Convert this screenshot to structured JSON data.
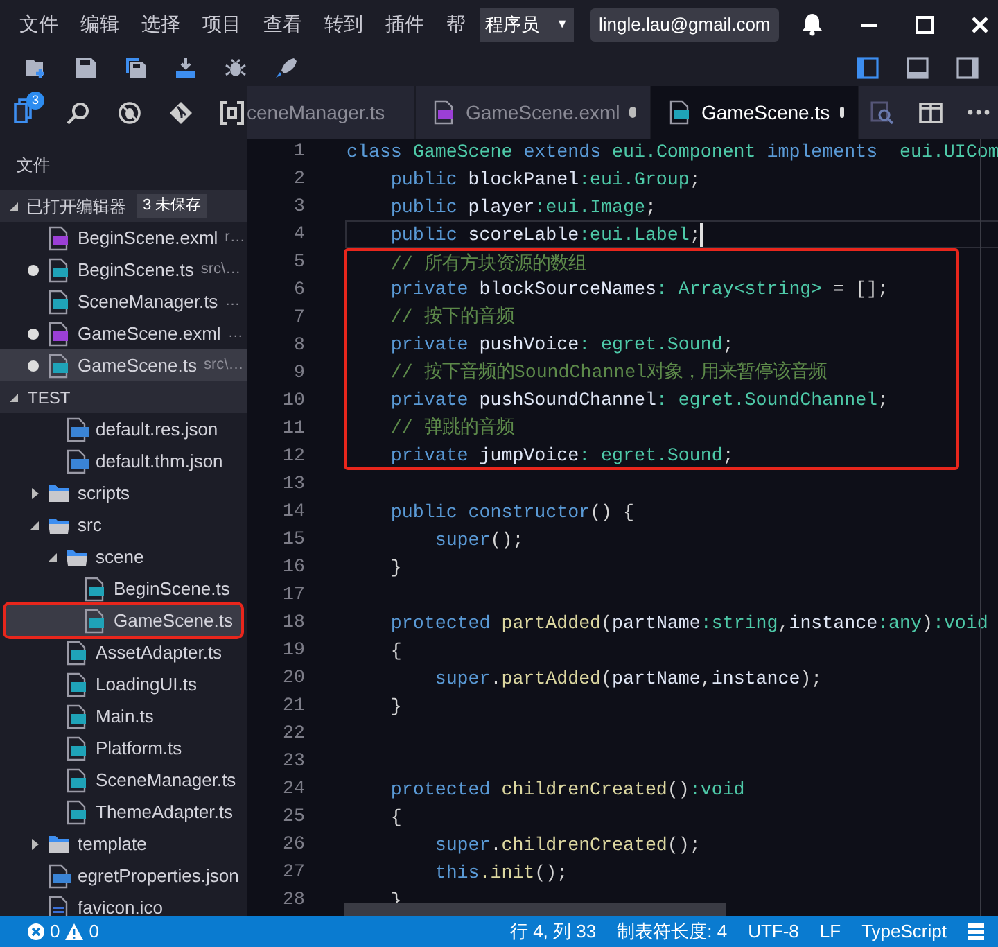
{
  "menu": [
    "文件",
    "编辑",
    "选择",
    "项目",
    "查看",
    "转到",
    "插件",
    "帮"
  ],
  "role_dropdown": {
    "value": "程序员",
    "caret": "▼"
  },
  "account": "lingle.lau@gmail.com",
  "activity": {
    "badge": "3"
  },
  "tabs": [
    {
      "label": "ceneManager.ts",
      "modified": false,
      "selected": false
    },
    {
      "label": "GameScene.exml",
      "kind": "exml",
      "modified": true,
      "selected": false
    },
    {
      "label": "GameScene.ts",
      "kind": "ts",
      "modified": true,
      "selected": true
    }
  ],
  "sidebar": {
    "title": "文件",
    "open_editors": {
      "label": "已打开编辑器",
      "badge": "3 未保存",
      "expanded": true,
      "items": [
        {
          "label": "BeginScene.exml",
          "kind": "exml",
          "description": "r…",
          "modified": false,
          "selected": false
        },
        {
          "label": "BeginScene.ts",
          "kind": "ts",
          "description": "src\\…",
          "modified": true,
          "selected": false
        },
        {
          "label": "SceneManager.ts",
          "kind": "ts",
          "description": "…",
          "modified": false,
          "selected": false
        },
        {
          "label": "GameScene.exml",
          "kind": "exml",
          "description": "…",
          "modified": true,
          "selected": false
        },
        {
          "label": "GameScene.ts",
          "kind": "ts",
          "description": "src\\…",
          "modified": true,
          "selected": true
        }
      ]
    },
    "project": {
      "label": "TEST",
      "expanded": true,
      "tree": [
        {
          "children": [
            {
              "label": "default.res.json",
              "kind": "json",
              "selected": false,
              "boxed": false
            },
            {
              "label": "default.thm.json",
              "kind": "json",
              "selected": false,
              "boxed": false
            }
          ]
        },
        {
          "label": "scripts",
          "kind": "folder",
          "expanded": false,
          "selected": false,
          "boxed": false
        },
        {
          "label": "src",
          "kind": "folder",
          "expanded": true,
          "selected": false,
          "boxed": false,
          "children": [
            {
              "label": "scene",
              "kind": "folder",
              "expanded": true,
              "selected": false,
              "boxed": false,
              "children": [
                {
                  "label": "BeginScene.ts",
                  "kind": "ts",
                  "selected": false,
                  "boxed": false
                },
                {
                  "label": "GameScene.ts",
                  "kind": "ts",
                  "selected": true,
                  "boxed": true
                }
              ]
            },
            {
              "label": "AssetAdapter.ts",
              "kind": "ts",
              "selected": false,
              "boxed": false
            },
            {
              "label": "LoadingUI.ts",
              "kind": "ts",
              "selected": false,
              "boxed": false
            },
            {
              "label": "Main.ts",
              "kind": "ts",
              "selected": false,
              "boxed": false
            },
            {
              "label": "Platform.ts",
              "kind": "ts",
              "selected": false,
              "boxed": false
            },
            {
              "label": "SceneManager.ts",
              "kind": "ts",
              "selected": false,
              "boxed": false
            },
            {
              "label": "ThemeAdapter.ts",
              "kind": "ts",
              "selected": false,
              "boxed": false
            }
          ]
        },
        {
          "label": "template",
          "kind": "folder",
          "expanded": false,
          "selected": false,
          "boxed": false
        },
        {
          "label": "egretProperties.json",
          "kind": "json",
          "selected": false,
          "boxed": false
        },
        {
          "label": "favicon.ico",
          "kind": "ico",
          "selected": false,
          "boxed": false
        }
      ]
    }
  },
  "code": {
    "lines": [
      {
        "number": "1",
        "current": false,
        "boxed": false,
        "tokens": [
          {
            "kind": "keyword",
            "text": "class "
          },
          {
            "kind": "type",
            "text": "GameScene "
          },
          {
            "kind": "keyword",
            "text": "extends "
          },
          {
            "kind": "type",
            "text": "eui.Component "
          },
          {
            "kind": "keyword",
            "text": "implements  "
          },
          {
            "kind": "type",
            "text": "eui.UICom"
          }
        ]
      },
      {
        "number": "2",
        "current": false,
        "boxed": false,
        "tokens": [
          {
            "kind": "keyword",
            "text": "    public "
          },
          {
            "kind": "name",
            "text": "blockPanel"
          },
          {
            "kind": "type",
            "text": ":eui.Group"
          },
          {
            "kind": "plain",
            "text": ";"
          }
        ]
      },
      {
        "number": "3",
        "current": false,
        "boxed": false,
        "tokens": [
          {
            "kind": "keyword",
            "text": "    public "
          },
          {
            "kind": "name",
            "text": "player"
          },
          {
            "kind": "type",
            "text": ":eui.Image"
          },
          {
            "kind": "plain",
            "text": ";"
          }
        ]
      },
      {
        "number": "4",
        "current": true,
        "boxed": false,
        "tokens": [
          {
            "kind": "keyword",
            "text": "    public "
          },
          {
            "kind": "name",
            "text": "scoreLable"
          },
          {
            "kind": "type",
            "text": ":eui.Label"
          },
          {
            "kind": "plain",
            "text": ";"
          }
        ]
      },
      {
        "number": "5",
        "current": false,
        "boxed": true,
        "tokens": [
          {
            "kind": "comment",
            "text": "    // 所有方块资源的数组"
          }
        ]
      },
      {
        "number": "6",
        "current": false,
        "boxed": true,
        "tokens": [
          {
            "kind": "keyword",
            "text": "    private "
          },
          {
            "kind": "name",
            "text": "blockSourceNames"
          },
          {
            "kind": "type",
            "text": ": Array<string>"
          },
          {
            "kind": "plain",
            "text": " = [];"
          }
        ]
      },
      {
        "number": "7",
        "current": false,
        "boxed": true,
        "tokens": [
          {
            "kind": "comment",
            "text": "    // 按下的音频"
          }
        ]
      },
      {
        "number": "8",
        "current": false,
        "boxed": true,
        "tokens": [
          {
            "kind": "keyword",
            "text": "    private "
          },
          {
            "kind": "name",
            "text": "pushVoice"
          },
          {
            "kind": "type",
            "text": ": egret.Sound"
          },
          {
            "kind": "plain",
            "text": ";"
          }
        ]
      },
      {
        "number": "9",
        "current": false,
        "boxed": true,
        "tokens": [
          {
            "kind": "comment",
            "text": "    // 按下音频的SoundChannel对象，用来暂停该音频"
          }
        ]
      },
      {
        "number": "10",
        "current": false,
        "boxed": true,
        "tokens": [
          {
            "kind": "keyword",
            "text": "    private "
          },
          {
            "kind": "name",
            "text": "pushSoundChannel"
          },
          {
            "kind": "type",
            "text": ": egret.SoundChannel"
          },
          {
            "kind": "plain",
            "text": ";"
          }
        ]
      },
      {
        "number": "11",
        "current": false,
        "boxed": true,
        "tokens": [
          {
            "kind": "comment",
            "text": "    // 弹跳的音频"
          }
        ]
      },
      {
        "number": "12",
        "current": false,
        "boxed": true,
        "tokens": [
          {
            "kind": "keyword",
            "text": "    private "
          },
          {
            "kind": "name",
            "text": "jumpVoice"
          },
          {
            "kind": "type",
            "text": ": egret.Sound"
          },
          {
            "kind": "plain",
            "text": ";"
          }
        ]
      },
      {
        "number": "13"
      },
      {
        "number": "14",
        "current": false,
        "boxed": false,
        "tokens": [
          {
            "kind": "keyword",
            "text": "    public constructor"
          },
          {
            "kind": "plain",
            "text": "() {"
          }
        ]
      },
      {
        "number": "15",
        "current": false,
        "boxed": false,
        "tokens": [
          {
            "kind": "keyword",
            "text": "        super"
          },
          {
            "kind": "plain",
            "text": "();"
          }
        ]
      },
      {
        "number": "16",
        "current": false,
        "boxed": false,
        "tokens": [
          {
            "kind": "plain",
            "text": "    }"
          }
        ]
      },
      {
        "number": "17"
      },
      {
        "number": "18",
        "current": false,
        "boxed": false,
        "tokens": [
          {
            "kind": "keyword",
            "text": "    protected "
          },
          {
            "kind": "function",
            "text": "partAdded"
          },
          {
            "kind": "plain",
            "text": "("
          },
          {
            "kind": "name",
            "text": "partName"
          },
          {
            "kind": "type",
            "text": ":string"
          },
          {
            "kind": "plain",
            "text": ","
          },
          {
            "kind": "name",
            "text": "instance"
          },
          {
            "kind": "type",
            "text": ":any"
          },
          {
            "kind": "plain",
            "text": ")"
          },
          {
            "kind": "type",
            "text": ":void"
          }
        ]
      },
      {
        "number": "19",
        "current": false,
        "boxed": false,
        "tokens": [
          {
            "kind": "plain",
            "text": "    {"
          }
        ]
      },
      {
        "number": "20",
        "current": false,
        "boxed": false,
        "tokens": [
          {
            "kind": "keyword",
            "text": "        super"
          },
          {
            "kind": "plain",
            "text": "."
          },
          {
            "kind": "function",
            "text": "partAdded"
          },
          {
            "kind": "plain",
            "text": "("
          },
          {
            "kind": "name",
            "text": "partName"
          },
          {
            "kind": "plain",
            "text": ","
          },
          {
            "kind": "name",
            "text": "instance"
          },
          {
            "kind": "plain",
            "text": ");"
          }
        ]
      },
      {
        "number": "21",
        "current": false,
        "boxed": false,
        "tokens": [
          {
            "kind": "plain",
            "text": "    }"
          }
        ]
      },
      {
        "number": "22"
      },
      {
        "number": "23"
      },
      {
        "number": "24",
        "current": false,
        "boxed": false,
        "tokens": [
          {
            "kind": "keyword",
            "text": "    protected "
          },
          {
            "kind": "function",
            "text": "childrenCreated"
          },
          {
            "kind": "plain",
            "text": "()"
          },
          {
            "kind": "type",
            "text": ":void"
          }
        ]
      },
      {
        "number": "25",
        "current": false,
        "boxed": false,
        "tokens": [
          {
            "kind": "plain",
            "text": "    {"
          }
        ]
      },
      {
        "number": "26",
        "current": false,
        "boxed": false,
        "tokens": [
          {
            "kind": "keyword",
            "text": "        super"
          },
          {
            "kind": "plain",
            "text": "."
          },
          {
            "kind": "function",
            "text": "childrenCreated"
          },
          {
            "kind": "plain",
            "text": "();"
          }
        ]
      },
      {
        "number": "27",
        "current": false,
        "boxed": false,
        "tokens": [
          {
            "kind": "keyword",
            "text": "        this"
          },
          {
            "kind": "function",
            "text": ".init"
          },
          {
            "kind": "plain",
            "text": "();"
          }
        ]
      },
      {
        "number": "28",
        "current": false,
        "boxed": false,
        "tokens": [
          {
            "kind": "plain",
            "text": "    }"
          }
        ]
      }
    ]
  },
  "status_bar": {
    "errors": "0",
    "warnings": "0",
    "position": "行 4, 列 33",
    "tab_size": "制表符长度: 4",
    "encoding": "UTF-8",
    "eol": "LF",
    "language": "TypeScript"
  }
}
